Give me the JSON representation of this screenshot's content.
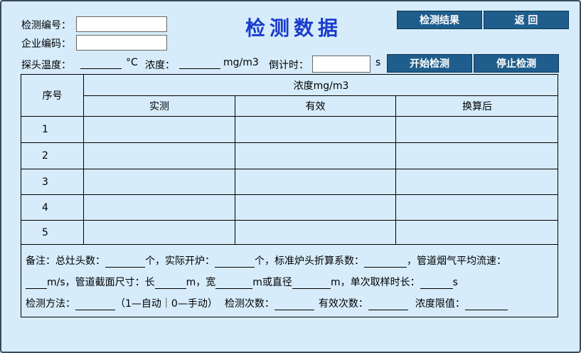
{
  "header": {
    "title": "检测数据",
    "check_no_label": "检测编号：",
    "check_no_value": "",
    "company_no_label": "企业编码：",
    "company_no_value": "",
    "result_button": "检测结果",
    "back_button": "返 回"
  },
  "params": {
    "probe_temp_label": "探头温度：",
    "probe_temp_unit": "°C",
    "concentration_label": "浓度：",
    "concentration_unit": "mg/m3",
    "countdown_label": "倒计时：",
    "countdown_value": "",
    "countdown_unit": "s",
    "start_button": "开始检测",
    "stop_button": "停止检测"
  },
  "table": {
    "col_index": "序号",
    "group_header": "浓度mg/m3",
    "col_measured": "实测",
    "col_valid": "有效",
    "col_converted": "换算后",
    "rows": [
      {
        "index": "1",
        "measured": "",
        "valid": "",
        "converted": ""
      },
      {
        "index": "2",
        "measured": "",
        "valid": "",
        "converted": ""
      },
      {
        "index": "3",
        "measured": "",
        "valid": "",
        "converted": ""
      },
      {
        "index": "4",
        "measured": "",
        "valid": "",
        "converted": ""
      },
      {
        "index": "5",
        "measured": "",
        "valid": "",
        "converted": ""
      }
    ]
  },
  "notes": {
    "l1_a": "备注：总灶头数：",
    "l1_b": "个，实际开炉：",
    "l1_c": "个，标准炉头折算系数：",
    "l1_d": "，管道烟气平均流速：",
    "l2_a": "m/s，管道截面尺寸：长",
    "l2_b": "m，宽",
    "l2_c": "m或直径",
    "l2_d": "m，单次取样时长：",
    "l2_e": "s",
    "l3_a": "检测方法：",
    "l3_b": "（1—自动｜0—手动）",
    "l3_c": "检测次数：",
    "l3_d": "有效次数：",
    "l3_e": "浓度限值："
  },
  "colors": {
    "background": "#d6ecfb",
    "button": "#1f5e8c",
    "title": "#1a3ccc"
  }
}
